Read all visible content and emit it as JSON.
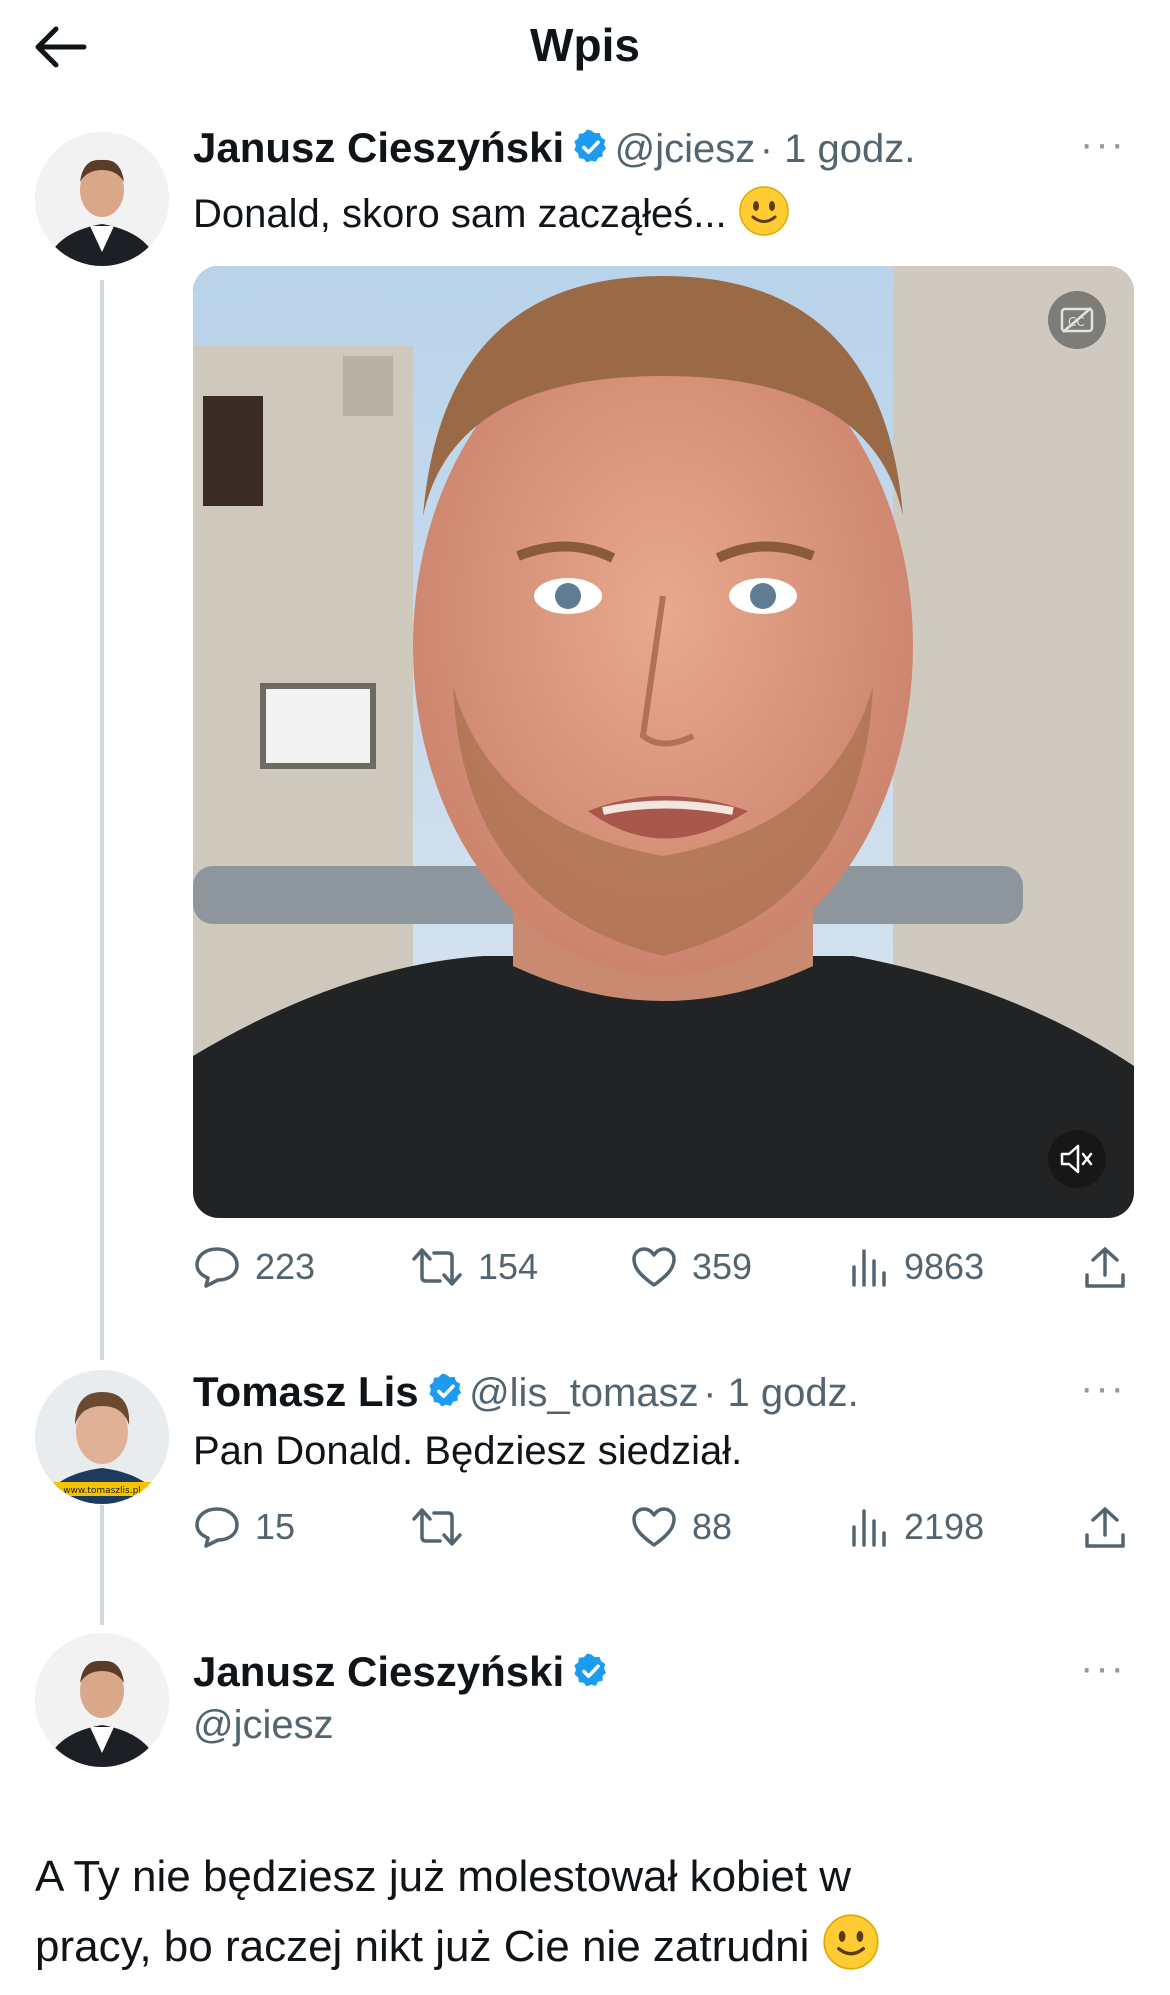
{
  "header": {
    "title": "Wpis"
  },
  "tweet1": {
    "name": "Janusz Cieszyński",
    "handle": "@jciesz",
    "time": "· 1 godz.",
    "text": "Donald, skoro sam zacząłeś...",
    "stats": {
      "replies": "223",
      "retweets": "154",
      "likes": "359",
      "views": "9863"
    }
  },
  "tweet2": {
    "name": "Tomasz Lis",
    "handle": "@lis_tomasz",
    "time": "· 1 godz.",
    "text": "Pan Donald. Będziesz siedział.",
    "stats": {
      "replies": "15",
      "retweets": "",
      "likes": "88",
      "views": "2198"
    }
  },
  "tweet3": {
    "name": "Janusz Cieszyński",
    "handle": "@jciesz",
    "text_line1": "A Ty nie będziesz już molestował kobiet w",
    "text_line2": "pracy, bo raczej nikt już Cie nie zatrudni"
  },
  "colors": {
    "verified": "#1d9bf0",
    "muted": "#536471",
    "thread": "#cfd9de"
  }
}
